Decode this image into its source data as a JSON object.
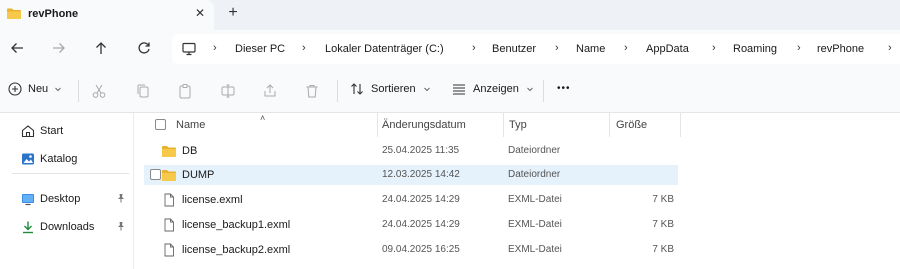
{
  "tab": {
    "title": "revPhone",
    "close": "✕",
    "add": "+"
  },
  "breadcrumb": [
    "Dieser PC",
    "Lokaler Datenträger (C:)",
    "Benutzer",
    "Name",
    "AppData",
    "Roaming",
    "revPhone"
  ],
  "toolbar": {
    "new_label": "Neu",
    "sort_label": "Sortieren",
    "view_label": "Anzeigen",
    "more_label": "•••"
  },
  "sidebar": {
    "items": [
      {
        "label": "Start",
        "icon": "home-icon"
      },
      {
        "label": "Katalog",
        "icon": "gallery-icon"
      },
      {
        "label": "Desktop",
        "icon": "desktop-icon"
      },
      {
        "label": "Downloads",
        "icon": "downloads-icon"
      }
    ]
  },
  "columns": {
    "name": "Name",
    "date": "Änderungsdatum",
    "type": "Typ",
    "size": "Größe"
  },
  "files": [
    {
      "name": "DB",
      "date": "25.04.2025 11:35",
      "type": "Dateiordner",
      "size": "",
      "kind": "folder",
      "selected": false
    },
    {
      "name": "DUMP",
      "date": "12.03.2025 14:42",
      "type": "Dateiordner",
      "size": "",
      "kind": "folder",
      "selected": true
    },
    {
      "name": "license.exml",
      "date": "24.04.2025 14:29",
      "type": "EXML-Datei",
      "size": "7 KB",
      "kind": "file",
      "selected": false
    },
    {
      "name": "license_backup1.exml",
      "date": "24.04.2025 14:29",
      "type": "EXML-Datei",
      "size": "7 KB",
      "kind": "file",
      "selected": false
    },
    {
      "name": "license_backup2.exml",
      "date": "09.04.2025 16:25",
      "type": "EXML-Datei",
      "size": "7 KB",
      "kind": "file",
      "selected": false
    }
  ],
  "colors": {
    "folder": "#f4c542",
    "accent": "#0067c0",
    "selection": "#e5f1fb"
  }
}
